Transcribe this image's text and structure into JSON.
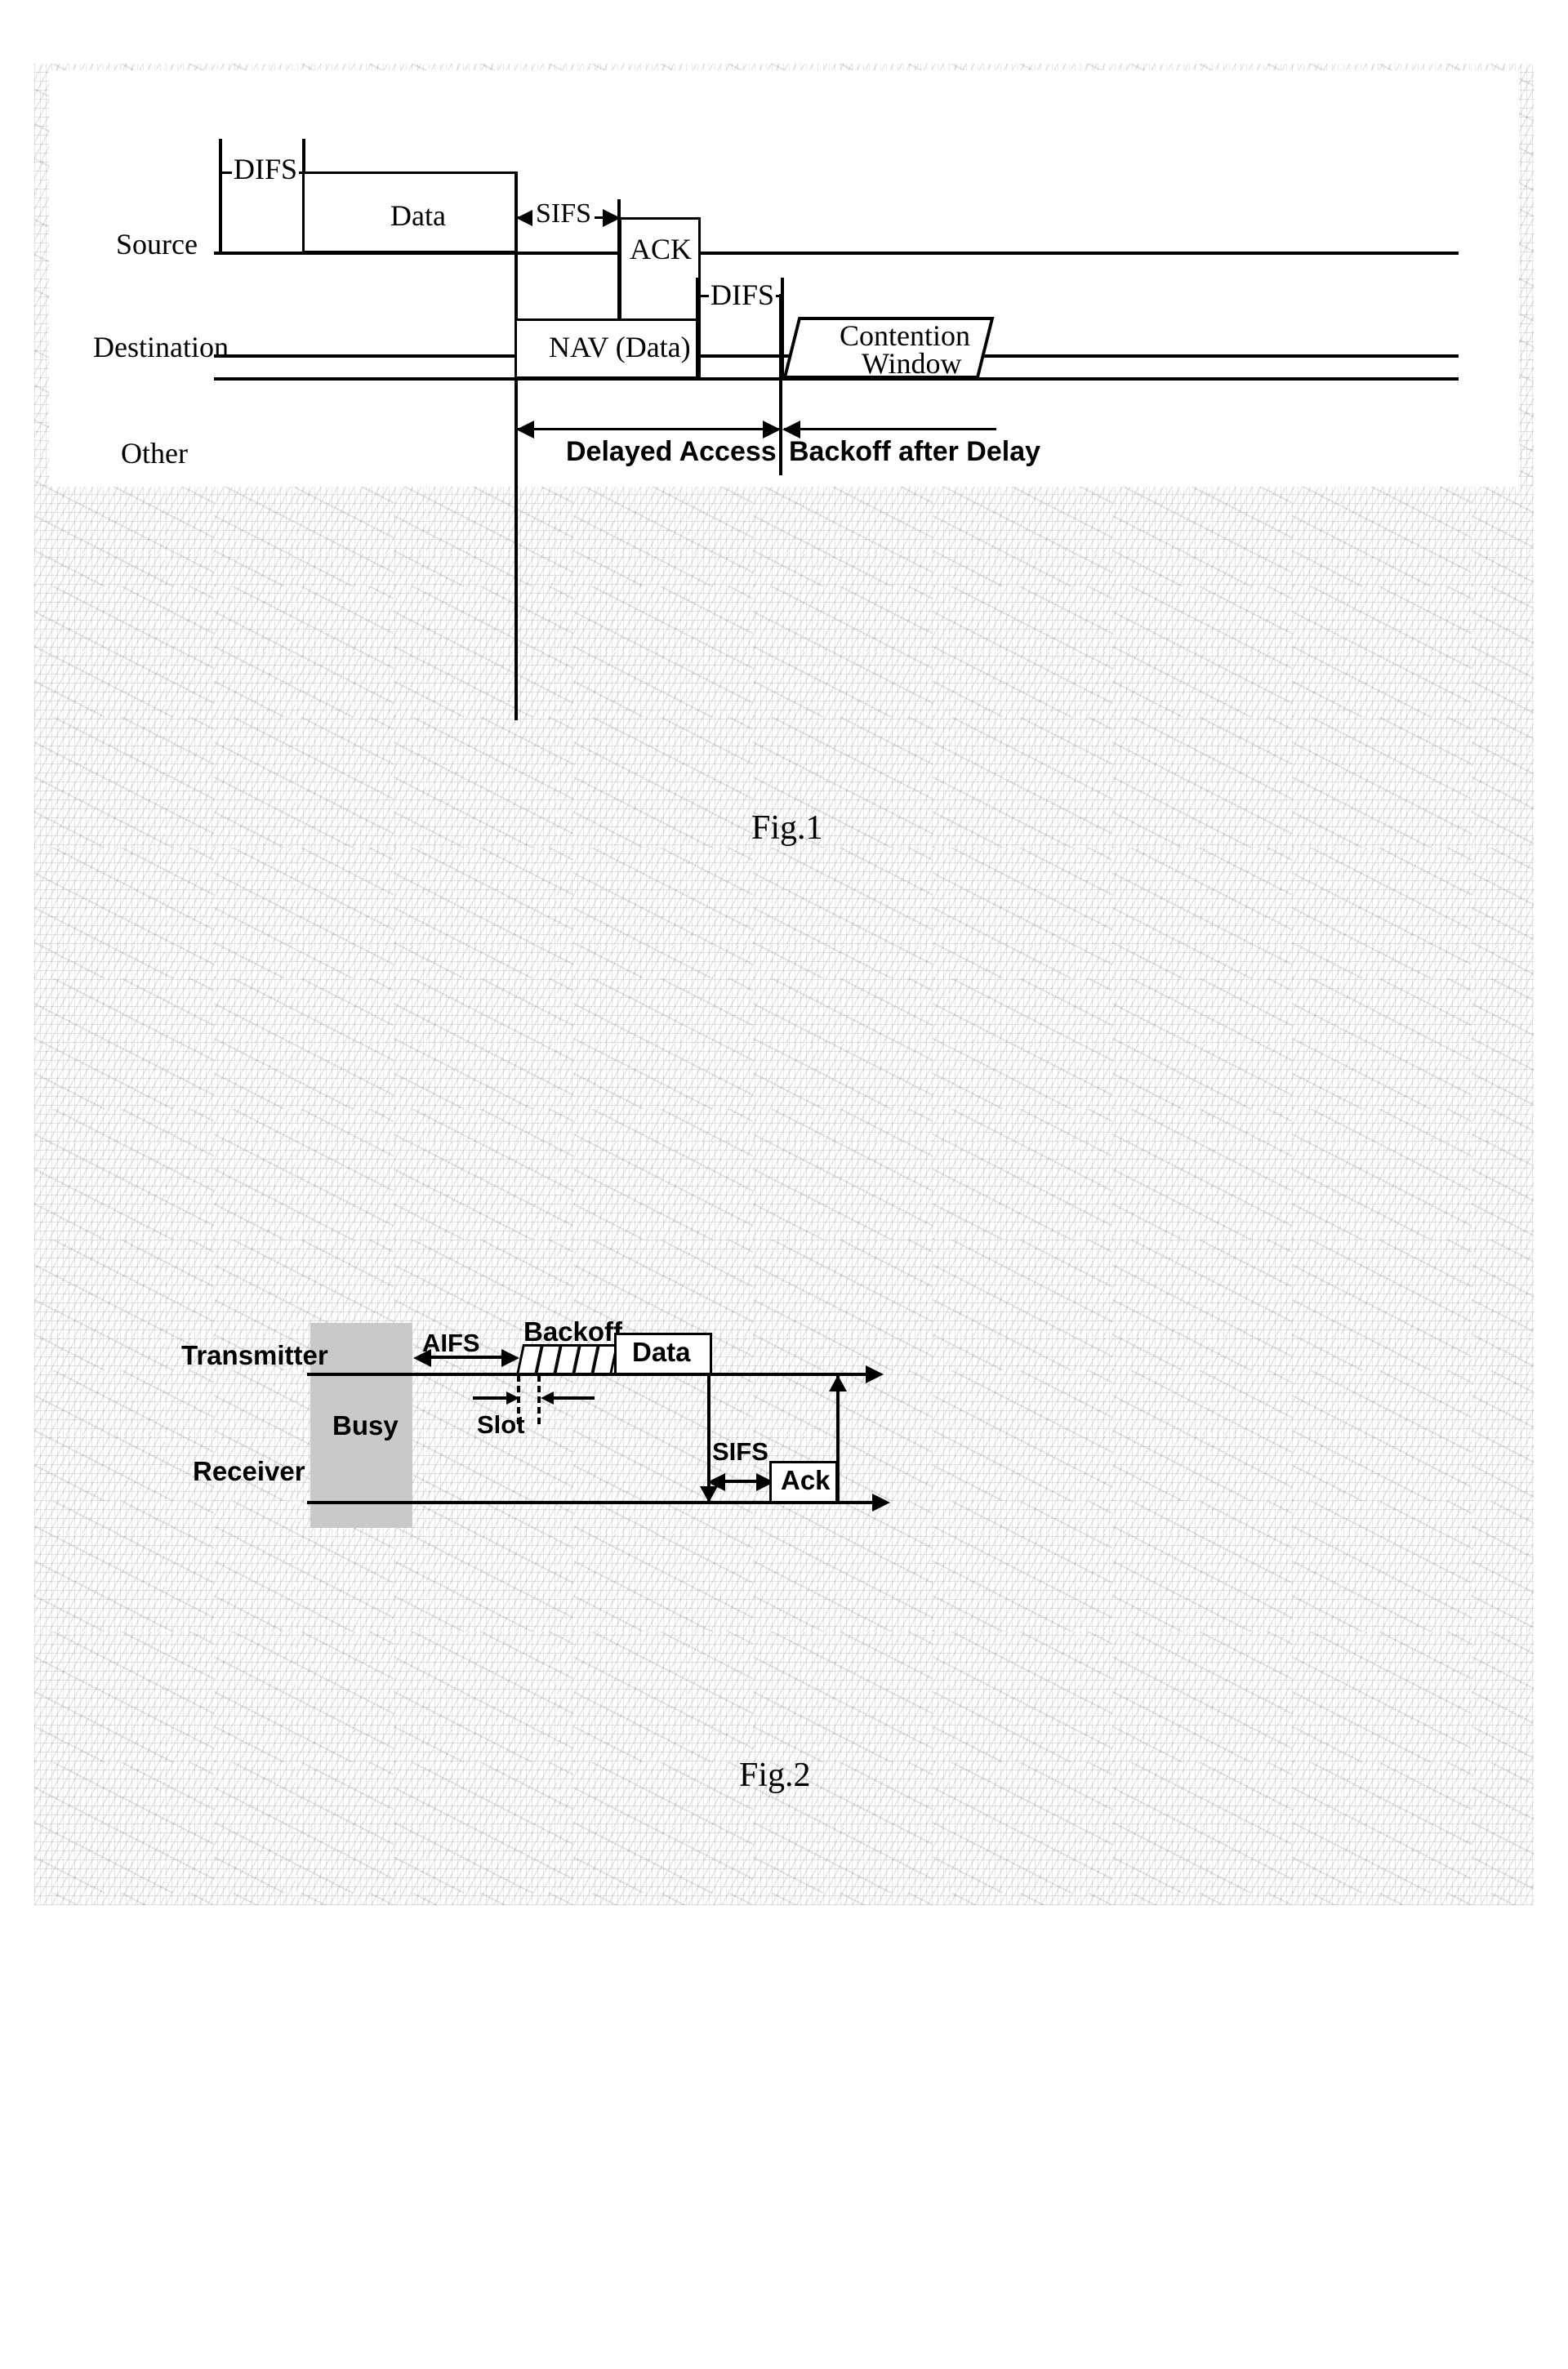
{
  "document": {
    "type": "patent-drawing-sheet",
    "background": "scanned-speckled-paper"
  },
  "figure1": {
    "caption": "Fig.1",
    "rows": [
      {
        "label": "Source"
      },
      {
        "label": "Destination"
      },
      {
        "label": "Other"
      }
    ],
    "blocks": [
      {
        "name": "data-block",
        "label": "Data"
      },
      {
        "name": "ack-block",
        "label": "ACK"
      },
      {
        "name": "nav-block",
        "label": "NAV (Data)"
      },
      {
        "name": "contention-window-block",
        "label_line1": "Contention",
        "label_line2": "Window"
      }
    ],
    "intervals": [
      {
        "name": "difs-source",
        "label": "DIFS"
      },
      {
        "name": "sifs-destination",
        "label": "SIFS"
      },
      {
        "name": "difs-other",
        "label": "DIFS"
      }
    ],
    "measures": [
      {
        "name": "delayed-access-measure",
        "label": "Delayed Access"
      },
      {
        "name": "backoff-after-delay-measure",
        "label": "Backoff after Delay"
      }
    ]
  },
  "figure2": {
    "caption": "Fig.2",
    "rows": [
      {
        "label": "Transmitter"
      },
      {
        "label": "Receiver"
      }
    ],
    "blocks": [
      {
        "name": "busy-block",
        "label": "Busy",
        "color": "#c9c9c9"
      },
      {
        "name": "data-block",
        "label": "Data"
      },
      {
        "name": "ack-block",
        "label": "Ack"
      }
    ],
    "intervals": [
      {
        "name": "aifs-interval",
        "label": "AIFS"
      },
      {
        "name": "backoff-interval",
        "label": "Backoff"
      },
      {
        "name": "slot-interval",
        "label": "Slot"
      },
      {
        "name": "sifs-interval",
        "label": "SIFS"
      }
    ],
    "backoff_slot_count": 5
  },
  "colors": {
    "ink": "#000000",
    "busy_fill": "#c9c9c9",
    "paper": "#ffffff"
  }
}
